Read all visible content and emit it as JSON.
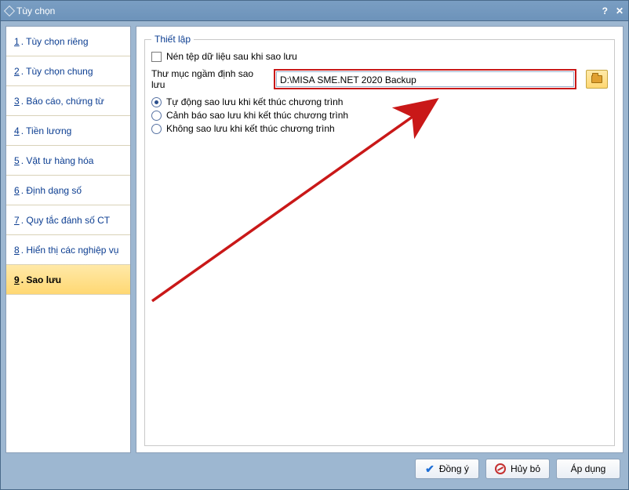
{
  "window": {
    "title": "Tùy chọn"
  },
  "sidebar": {
    "items": [
      {
        "num": "1",
        "label": ". Tùy chọn riêng"
      },
      {
        "num": "2",
        "label": ". Tùy chọn chung"
      },
      {
        "num": "3",
        "label": ". Báo cáo, chứng từ"
      },
      {
        "num": "4",
        "label": ". Tiền lương"
      },
      {
        "num": "5",
        "label": ". Vật tư hàng hóa"
      },
      {
        "num": "6",
        "label": ". Định dạng số"
      },
      {
        "num": "7",
        "label": ". Quy tắc đánh số CT"
      },
      {
        "num": "8",
        "label": ". Hiển thị các nghiệp vụ"
      },
      {
        "num": "9",
        "label": ". Sao lưu"
      }
    ],
    "active_index": 8
  },
  "settings": {
    "fieldset_title": "Thiết lập",
    "compress_label": "Nén tệp dữ liệu sau khi sao lưu",
    "compress_checked": false,
    "dir_label": "Thư mục ngầm định sao lưu",
    "dir_value": "D:\\MISA SME.NET 2020 Backup",
    "radios": {
      "selected": 0,
      "opts": [
        "Tự động sao lưu khi kết thúc chương trình",
        "Cảnh báo sao lưu khi kết thúc chương trình",
        "Không sao lưu khi kết thúc chương trình"
      ]
    }
  },
  "footer": {
    "ok": "Đồng ý",
    "cancel": "Hủy bỏ",
    "apply": "Áp dụng"
  }
}
